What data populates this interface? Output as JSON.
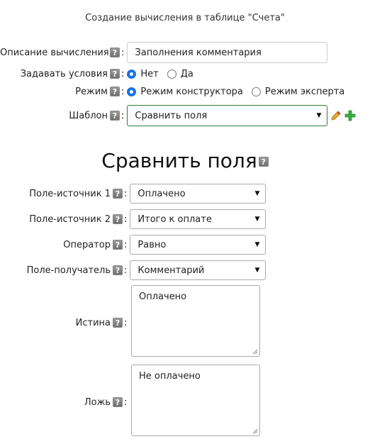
{
  "header": {
    "title": "Создание вычисления в таблице \"Счета\""
  },
  "help_glyph": "?",
  "form": {
    "description_label": "Описание вычисления",
    "description_value": "Заполнения комментария",
    "conditions_label": "Задавать условия",
    "conditions_options": [
      "Нет",
      "Да"
    ],
    "conditions_selected": "Нет",
    "mode_label": "Режим",
    "mode_options": [
      "Режим конструктора",
      "Режим эксперта"
    ],
    "mode_selected": "Режим конструктора",
    "template_label": "Шаблон",
    "template_value": "Сравнить поля"
  },
  "section": {
    "heading": "Сравнить поля",
    "source1_label": "Поле-источник 1",
    "source1_value": "Оплачено",
    "source2_label": "Поле-источник 2",
    "source2_value": "Итого к оплате",
    "operator_label": "Оператор",
    "operator_value": "Равно",
    "target_label": "Поле-получатель",
    "target_value": "Комментарий",
    "true_label": "Истина",
    "true_value": "Оплачено",
    "false_label": "Ложь",
    "false_value": "Не оплачено"
  },
  "colors": {
    "radio_checked": "#1a73e8",
    "template_border": "#2e7d32",
    "plus": "#3cb043",
    "pencil": "#e0a020"
  },
  "icons": [
    "help-icon",
    "pencil-icon",
    "plus-icon",
    "chevron-down-icon",
    "resize-grip-icon"
  ]
}
